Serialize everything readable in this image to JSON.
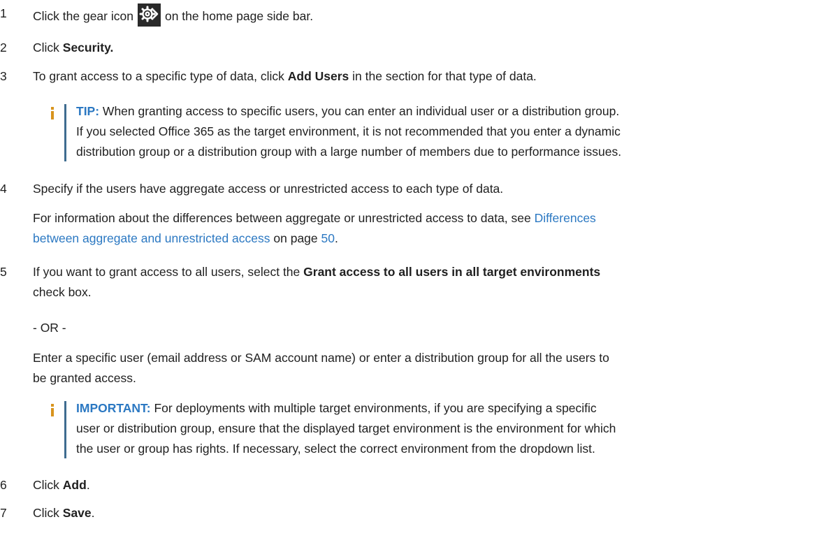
{
  "steps": [
    {
      "num": "1",
      "pre": "Click the gear icon",
      "post": "on the home page side bar."
    },
    {
      "num": "2",
      "pre": "Click ",
      "bold": "Security."
    },
    {
      "num": "3",
      "pre": "To grant access to a specific type of data, click ",
      "bold": "Add Users",
      "post": " in the section for that type of data."
    },
    {
      "num": "4",
      "text": "Specify if the users have aggregate access or unrestricted access to each type of data."
    },
    {
      "num": "5",
      "pre": "If you want to grant access to all users, select the ",
      "bold": "Grant access to all users in all target environments",
      "post": "check box."
    },
    {
      "num": "6",
      "pre": "Click ",
      "bold": "Add",
      "post": "."
    },
    {
      "num": "7",
      "pre": "Click ",
      "bold": "Save",
      "post": "."
    }
  ],
  "tip": {
    "label": "TIP:",
    "line1": " When granting access to specific users, you can enter an individual user or a distribution group.",
    "line2": "If you selected Office 365 as the target environment, it is not recommended that you enter a dynamic",
    "line3": "distribution group or a distribution group with a large number of members due to performance issues."
  },
  "info": {
    "pre": "For information about the differences between aggregate or unrestricted access to data, see ",
    "link1": "Differences",
    "link2": "between aggregate and unrestricted access",
    "mid": " on page ",
    "page": "50",
    "end": "."
  },
  "or_text": "- OR -",
  "enter_text": {
    "line1": "Enter a specific user (email address or SAM account name) or enter a distribution group for all the users to",
    "line2": "be granted access."
  },
  "important": {
    "label": "IMPORTANT:",
    "line1": " For deployments with multiple target environments, if you are specifying a specific",
    "line2": "user or distribution group, ensure that the displayed target environment is the environment for which",
    "line3": "the user or group has rights. If necessary, select the correct environment from the dropdown list."
  },
  "colors": {
    "accent": "#2b78c2",
    "note_bar": "#3f6c90",
    "info_icon": "#d8941e"
  },
  "icons": [
    "gear-icon",
    "info-icon"
  ]
}
